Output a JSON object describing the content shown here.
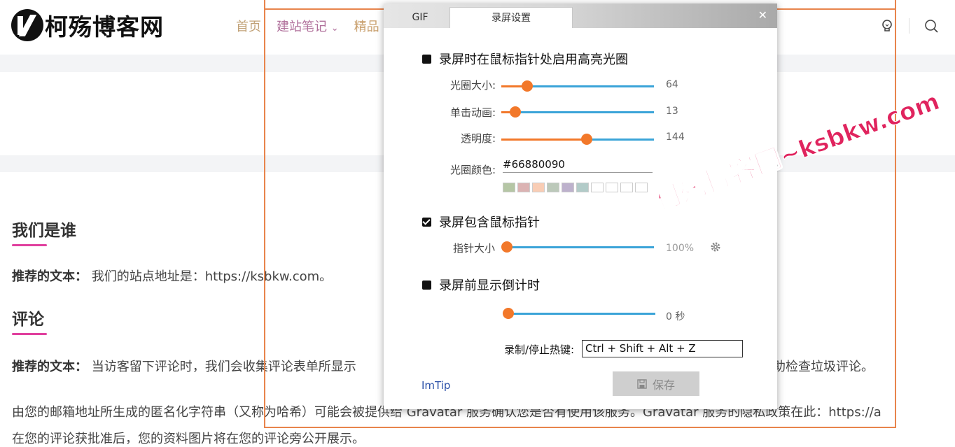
{
  "site": {
    "logo_text": "柯殇博客网",
    "nav": [
      "首页",
      "建站笔记",
      "精品"
    ],
    "sections": [
      {
        "title": "我们是谁",
        "label": "推荐的文本：",
        "text": "我们的站点地址是：https://ksbkw.com。"
      },
      {
        "title": "评论",
        "label": "推荐的文本：",
        "text": "当访客留下评论时，我们会收集评论表单所显示",
        "text_tail": "助检查垃圾评论。"
      }
    ],
    "para3": "由您的邮箱地址所生成的匿名化字符串（又称为哈希）可能会被提供给 Gravatar 服务确认您是否有使用该服务。Gravatar 服务的隐私政策在此：https://a",
    "para4": "在您的评论获批准后，您的资料图片将在您的评论旁公开展示。"
  },
  "dialog": {
    "tabs": [
      "GIF",
      "录屏设置"
    ],
    "active_tab": "录屏设置",
    "options": {
      "highlight": {
        "label": "录屏时在鼠标指针处启用高亮光圈",
        "checked": false
      },
      "include_cursor": {
        "label": "录屏包含鼠标指针",
        "checked": true
      },
      "countdown": {
        "label": "录屏前显示倒计时",
        "checked": false
      }
    },
    "sliders": {
      "circle_size": {
        "label": "光圈大小:",
        "value_text": "64",
        "fraction": 0.17
      },
      "click_anim": {
        "label": "单击动画:",
        "value_text": "13",
        "fraction": 0.09
      },
      "opacity": {
        "label": "透明度:",
        "value_text": "144",
        "fraction": 0.56
      },
      "pointer_size": {
        "label": "指针大小",
        "value_text": "100%",
        "fraction": 0.0
      },
      "countdown": {
        "value_text": "0 秒",
        "fraction": 0.0
      }
    },
    "circle_color": {
      "label": "光圈颜色:",
      "value": "#66880090"
    },
    "swatches": [
      "#b5c6a5",
      "#dbb3b3",
      "#f9cdb5",
      "#bcc9ba",
      "#bdb1cc",
      "#b2cbc8",
      "#ffffff",
      "#ffffff",
      "#ffffff",
      "#ffffff"
    ],
    "hotkey": {
      "label": "录制/停止热键:",
      "value": "Ctrl + Shift + Alt + Z"
    },
    "imtip": "ImTip",
    "save_label": "保存",
    "accent": "#f2782a",
    "track": "#3ba4d8"
  },
  "watermark": {
    "cn": "柯殇博客网",
    "en": "~ksbkw.com"
  }
}
